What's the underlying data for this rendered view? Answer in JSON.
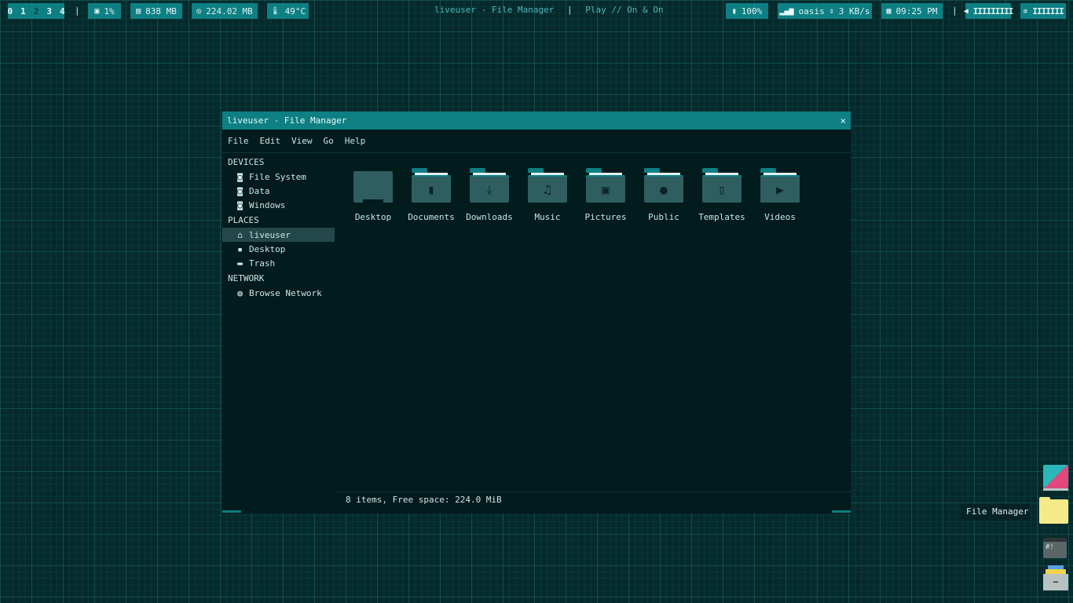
{
  "topbar": {
    "workspaces": [
      "0",
      "1",
      "2",
      "3",
      "4"
    ],
    "active_workspace_index": 2,
    "separator": "|",
    "cpu": "1%",
    "memory": "838 MB",
    "disk": "224.02 MB",
    "temperature": "49°C",
    "window_title": "liveuser - File Manager",
    "media": "Play // On & On",
    "battery": "100%",
    "network_name": "oasis",
    "network_speed": "3 KB/s",
    "clock": "09:25 PM",
    "volume_bars": "IIIIIIIII",
    "brightness_bars": "IIIIIII"
  },
  "window": {
    "title": "liveuser - File Manager",
    "close_glyph": "×",
    "menu": [
      "File",
      "Edit",
      "View",
      "Go",
      "Help"
    ],
    "sidebar": {
      "devices_heading": "DEVICES",
      "devices": [
        "File System",
        "Data",
        "Windows"
      ],
      "places_heading": "PLACES",
      "places": [
        "liveuser",
        "Desktop",
        "Trash"
      ],
      "network_heading": "NETWORK",
      "network": [
        "Browse Network"
      ]
    },
    "items": [
      "Desktop",
      "Documents",
      "Downloads",
      "Music",
      "Pictures",
      "Public",
      "Templates",
      "Videos"
    ],
    "status": "8 items, Free space: 224.0 MiB"
  },
  "dock": {
    "tooltip": "File Manager",
    "terminal_glyph": "#!",
    "archive_glyph": "−"
  },
  "colors": {
    "accent": "#0e7f83",
    "background": "#062a2c",
    "window_bg": "#021b1d",
    "folder_body": "#2f5e61",
    "selection": "#24474a"
  }
}
